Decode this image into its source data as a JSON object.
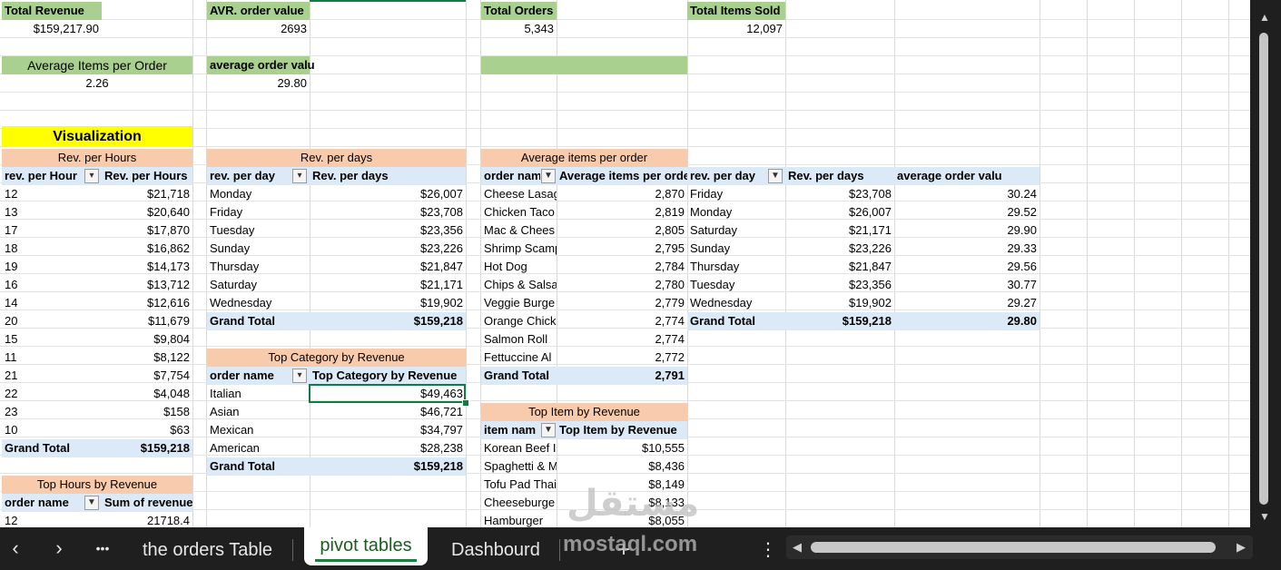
{
  "kpis": {
    "total_revenue_label": "Total Revenue",
    "total_revenue_value": "$159,217.90",
    "avr_order_label": "AVR. order value",
    "avr_order_value": "2693",
    "total_orders_label": "Total Orders",
    "total_orders_value": "5,343",
    "total_items_label": "Total Items Sold",
    "total_items_value": "12,097",
    "avg_items_label": "Average Items per Order",
    "avg_items_value": "2.26",
    "avg_order_value_label": "average order valu",
    "avg_order_value_value": "29.80"
  },
  "visualization_label": "Visualization",
  "rev_hours": {
    "title": "Rev. per Hours",
    "col1": "rev. per Hour",
    "col2": "Rev. per Hours",
    "rows": [
      [
        "12",
        "$21,718"
      ],
      [
        "13",
        "$20,640"
      ],
      [
        "17",
        "$17,870"
      ],
      [
        "18",
        "$16,862"
      ],
      [
        "19",
        "$14,173"
      ],
      [
        "16",
        "$13,712"
      ],
      [
        "14",
        "$12,616"
      ],
      [
        "20",
        "$11,679"
      ],
      [
        "15",
        "$9,804"
      ],
      [
        "11",
        "$8,122"
      ],
      [
        "21",
        "$7,754"
      ],
      [
        "22",
        "$4,048"
      ],
      [
        "23",
        "$158"
      ],
      [
        "10",
        "$63"
      ]
    ],
    "grand_label": "Grand Total",
    "grand_value": "$159,218"
  },
  "top_hours": {
    "title": "Top Hours by Revenue",
    "col1": "order name",
    "col2": "Sum of revenue",
    "rows": [
      [
        "12",
        "21718.4"
      ]
    ]
  },
  "rev_days": {
    "title": "Rev. per days",
    "col1": "rev. per day",
    "col2": "Rev. per days",
    "rows": [
      [
        "Monday",
        "$26,007"
      ],
      [
        "Friday",
        "$23,708"
      ],
      [
        "Tuesday",
        "$23,356"
      ],
      [
        "Sunday",
        "$23,226"
      ],
      [
        "Thursday",
        "$21,847"
      ],
      [
        "Saturday",
        "$21,171"
      ],
      [
        "Wednesday",
        "$19,902"
      ]
    ],
    "grand_label": "Grand Total",
    "grand_value": "$159,218"
  },
  "top_category": {
    "title": "Top Category by Revenue",
    "col1": "order name",
    "col2": "Top Category by Revenue",
    "rows": [
      [
        "Italian",
        "$49,463"
      ],
      [
        "Asian",
        "$46,721"
      ],
      [
        "Mexican",
        "$34,797"
      ],
      [
        "American",
        "$28,238"
      ]
    ],
    "grand_label": "Grand Total",
    "grand_value": "$159,218"
  },
  "avg_items": {
    "title": "Average items per order",
    "col1": "order nam",
    "col2": "Average items per orde",
    "rows": [
      [
        "Cheese Lasag",
        "2,870"
      ],
      [
        "Chicken Taco",
        "2,819"
      ],
      [
        "Mac & Chees",
        "2,805"
      ],
      [
        "Shrimp Scamp",
        "2,795"
      ],
      [
        "Hot Dog",
        "2,784"
      ],
      [
        "Chips & Salsa",
        "2,780"
      ],
      [
        "Veggie Burge",
        "2,779"
      ],
      [
        "Orange Chick",
        "2,774"
      ],
      [
        "Salmon Roll",
        "2,774"
      ],
      [
        "Fettuccine Al",
        "2,772"
      ]
    ],
    "grand_label": "Grand Total",
    "grand_value": "2,791"
  },
  "top_item": {
    "title": "Top Item by Revenue",
    "col1": "item nam",
    "col2": "Top Item by Revenue",
    "rows": [
      [
        "Korean Beef I",
        "$10,555"
      ],
      [
        "Spaghetti & M",
        "$8,436"
      ],
      [
        "Tofu Pad Thai",
        "$8,149"
      ],
      [
        "Cheeseburge",
        "$8,133"
      ],
      [
        "Hamburger",
        "$8,055"
      ]
    ]
  },
  "days_avg": {
    "col1": "rev. per day",
    "col2": "Rev. per days",
    "col3": "average order valu",
    "rows": [
      [
        "Friday",
        "$23,708",
        "30.24"
      ],
      [
        "Monday",
        "$26,007",
        "29.52"
      ],
      [
        "Saturday",
        "$21,171",
        "29.90"
      ],
      [
        "Sunday",
        "$23,226",
        "29.33"
      ],
      [
        "Thursday",
        "$21,847",
        "29.56"
      ],
      [
        "Tuesday",
        "$23,356",
        "30.77"
      ],
      [
        "Wednesday",
        "$19,902",
        "29.27"
      ]
    ],
    "grand_label": "Grand Total",
    "grand_value": "$159,218",
    "grand_avg": "29.80"
  },
  "tabs": {
    "orders": "the orders Table",
    "pivot": "pivot tables",
    "dashboard": "Dashbourd",
    "more": "•••",
    "add": "+",
    "options": "⋮"
  },
  "watermark": {
    "arabic": "مستقل",
    "latin": "mostaql.com"
  },
  "colors": {
    "green_header": "#a9d08e",
    "orange_header": "#f8cbad",
    "yellow_header": "#ffff00",
    "blue_header": "#dce9f6",
    "active_tab": "#1e7e3e"
  }
}
